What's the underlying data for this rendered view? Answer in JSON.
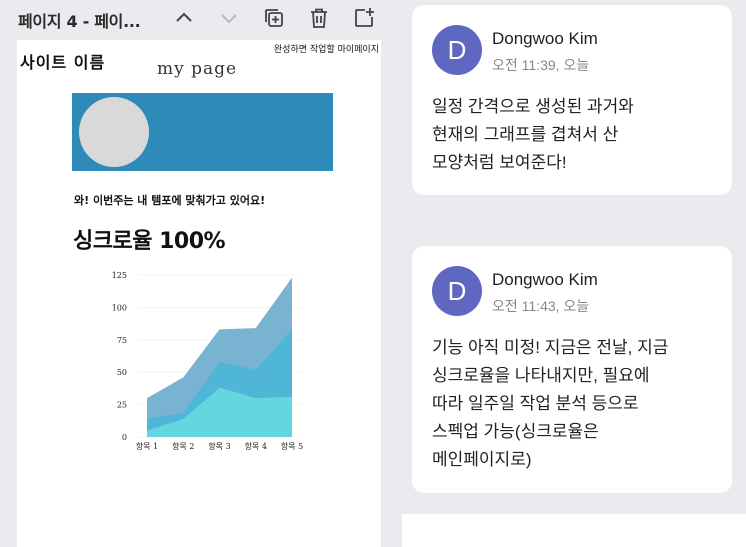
{
  "toolbar": {
    "page_tab": "페이지 4 - 페이...",
    "icons": [
      "chevron-up-icon",
      "chevron-down-icon",
      "duplicate-page-icon",
      "trash-icon",
      "add-page-icon"
    ]
  },
  "page": {
    "site_name": "사이트 이름",
    "top_note": "완성하면 작업할 마이페이지",
    "title": "my  page",
    "cheer": "와! 이번주는 내 템포에 맞춰가고 있어요!",
    "sync": "싱크로율 100%"
  },
  "chart_data": {
    "type": "area",
    "categories": [
      "항목 1",
      "항목 2",
      "항목 3",
      "항목 4",
      "항목 5"
    ],
    "ylim": [
      0,
      125
    ],
    "yticks": [
      0,
      25,
      50,
      75,
      100,
      125
    ],
    "series": [
      {
        "values": [
          30,
          46,
          83,
          84,
          123
        ],
        "color": "#79b3d2"
      },
      {
        "values": [
          14,
          19,
          58,
          52,
          83
        ],
        "color": "#4fb6d8"
      },
      {
        "values": [
          5,
          14,
          38,
          30,
          31
        ],
        "color": "#64d6e0"
      }
    ]
  },
  "comments": [
    {
      "avatar_letter": "D",
      "author": "Dongwoo Kim",
      "time": "오전 11:39, 오늘",
      "body": "일정 간격으로 생성된 과거와\n현재의 그래프를 겹쳐서 산\n모양처럼 보여준다!"
    },
    {
      "avatar_letter": "D",
      "author": "Dongwoo Kim",
      "time": "오전 11:43, 오늘",
      "body": "기능 아직 미정! 지금은 전날, 지금\n싱크로율을 나타내지만, 필요에\n따라 일주일 작업 분석 등으로\n스펙업 가능(싱크로율은\n메인페이지로)"
    }
  ]
}
